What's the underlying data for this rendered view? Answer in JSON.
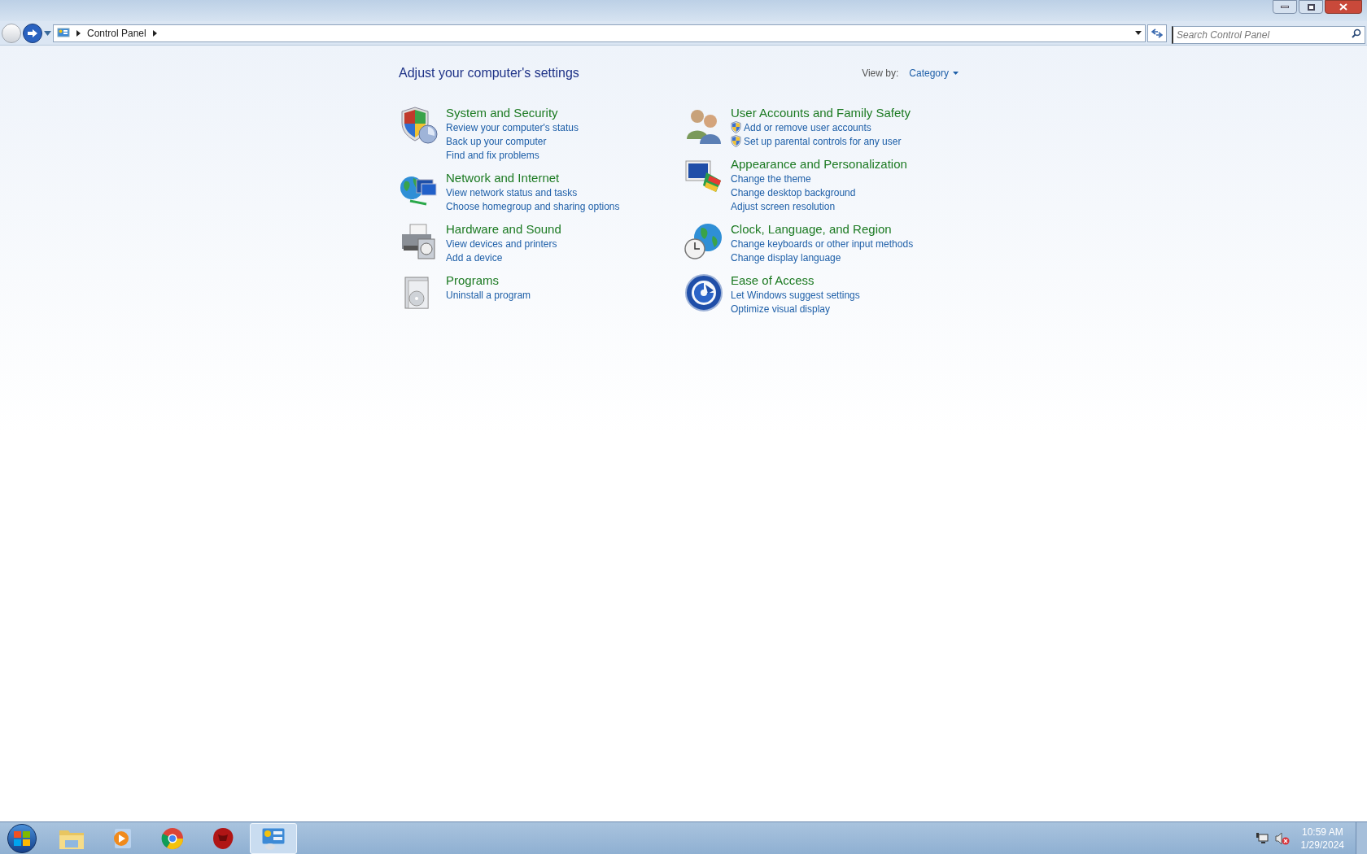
{
  "address_bar": {
    "breadcrumb": "Control Panel"
  },
  "search": {
    "placeholder": "Search Control Panel"
  },
  "heading": "Adjust your computer's settings",
  "view_by": {
    "label": "View by:",
    "value": "Category"
  },
  "columns": [
    {
      "categories": [
        {
          "title": "System and Security",
          "links": [
            {
              "text": "Review your computer's status",
              "shield": false
            },
            {
              "text": "Back up your computer",
              "shield": false
            },
            {
              "text": "Find and fix problems",
              "shield": false
            }
          ]
        },
        {
          "title": "Network and Internet",
          "links": [
            {
              "text": "View network status and tasks",
              "shield": false
            },
            {
              "text": "Choose homegroup and sharing options",
              "shield": false
            }
          ]
        },
        {
          "title": "Hardware and Sound",
          "links": [
            {
              "text": "View devices and printers",
              "shield": false
            },
            {
              "text": "Add a device",
              "shield": false
            }
          ]
        },
        {
          "title": "Programs",
          "links": [
            {
              "text": "Uninstall a program",
              "shield": false
            }
          ]
        }
      ]
    },
    {
      "categories": [
        {
          "title": "User Accounts and Family Safety",
          "links": [
            {
              "text": "Add or remove user accounts",
              "shield": true
            },
            {
              "text": "Set up parental controls for any user",
              "shield": true
            }
          ]
        },
        {
          "title": "Appearance and Personalization",
          "links": [
            {
              "text": "Change the theme",
              "shield": false
            },
            {
              "text": "Change desktop background",
              "shield": false
            },
            {
              "text": "Adjust screen resolution",
              "shield": false
            }
          ]
        },
        {
          "title": "Clock, Language, and Region",
          "links": [
            {
              "text": "Change keyboards or other input methods",
              "shield": false
            },
            {
              "text": "Change display language",
              "shield": false
            }
          ]
        },
        {
          "title": "Ease of Access",
          "links": [
            {
              "text": "Let Windows suggest settings",
              "shield": false
            },
            {
              "text": "Optimize visual display",
              "shield": false
            }
          ]
        }
      ]
    }
  ],
  "taskbar": {
    "apps": [
      {
        "selected": false
      },
      {
        "selected": false
      },
      {
        "selected": false
      },
      {
        "selected": false
      },
      {
        "selected": true
      }
    ],
    "clock": {
      "time": "10:59 AM",
      "date": "1/29/2024"
    }
  }
}
